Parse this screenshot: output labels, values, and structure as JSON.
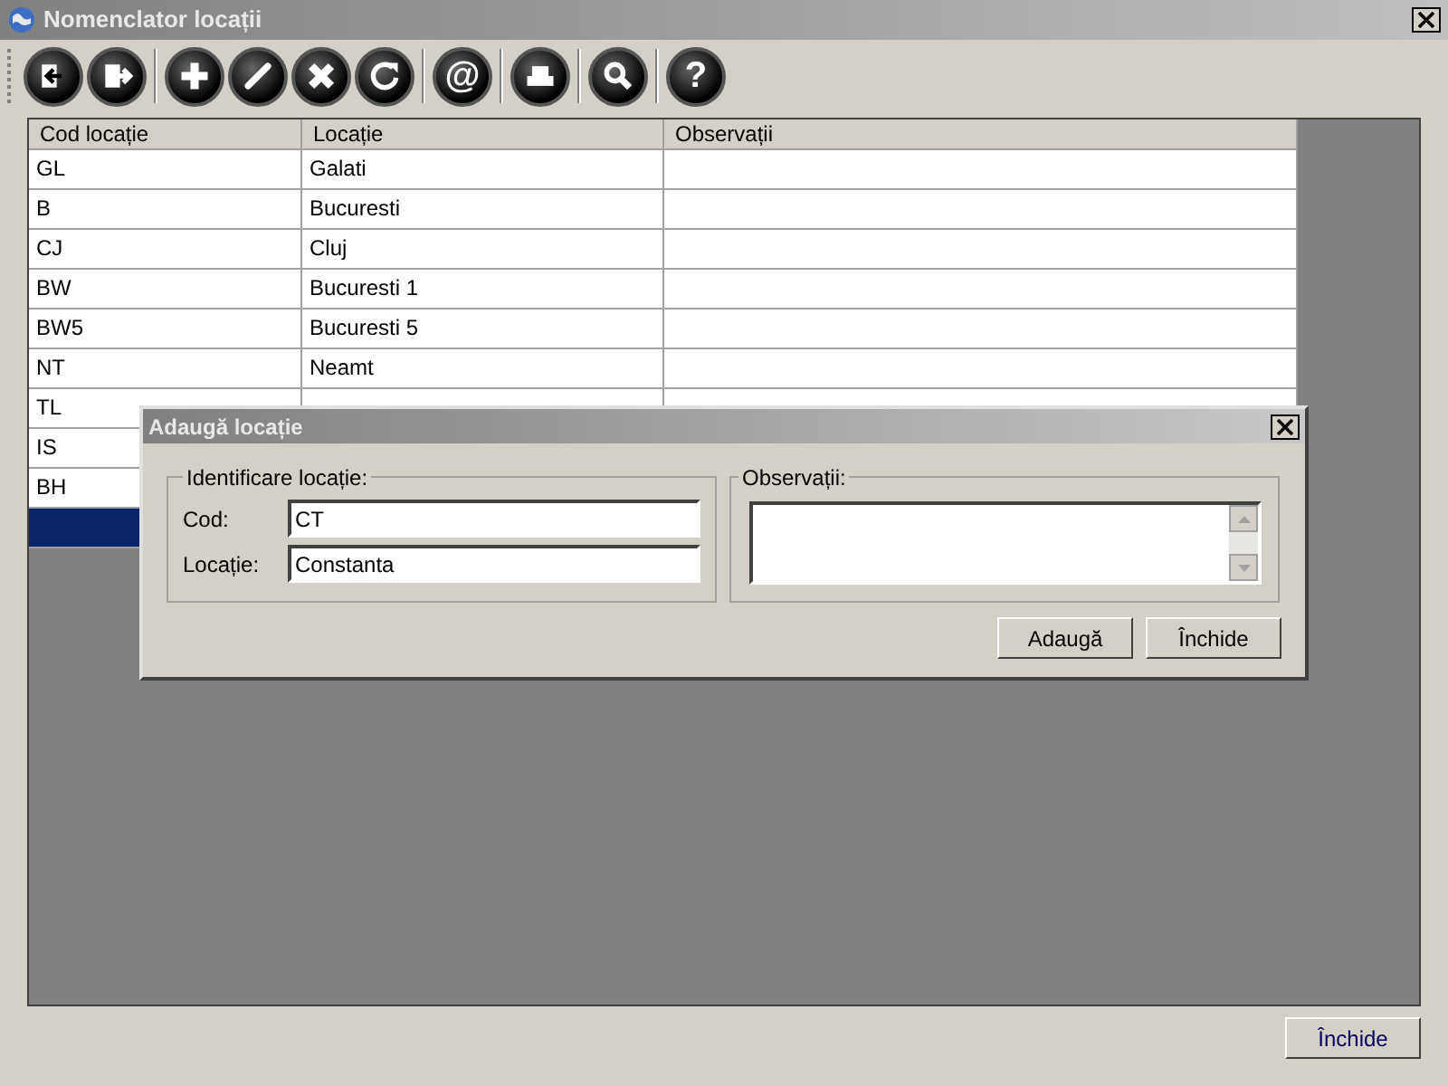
{
  "window": {
    "title": "Nomenclator locații"
  },
  "toolbar": [
    {
      "kind": "enter"
    },
    {
      "kind": "exit"
    },
    {
      "kind": "sep"
    },
    {
      "kind": "add"
    },
    {
      "kind": "edit"
    },
    {
      "kind": "delete"
    },
    {
      "kind": "refresh"
    },
    {
      "kind": "sep"
    },
    {
      "kind": "mail",
      "glyph": "@"
    },
    {
      "kind": "sep"
    },
    {
      "kind": "print"
    },
    {
      "kind": "sep"
    },
    {
      "kind": "search"
    },
    {
      "kind": "sep"
    },
    {
      "kind": "help",
      "glyph": "?"
    }
  ],
  "table": {
    "columns": [
      "Cod locație",
      "Locație",
      "Observații"
    ],
    "rows": [
      {
        "cells": [
          "GL",
          "Galati"
        ],
        "selected": false
      },
      {
        "cells": [
          "B",
          "Bucuresti"
        ],
        "selected": false
      },
      {
        "cells": [
          "CJ",
          "Cluj"
        ],
        "selected": false
      },
      {
        "cells": [
          "BW",
          "Bucuresti 1"
        ],
        "selected": false
      },
      {
        "cells": [
          "BW5",
          "Bucuresti 5"
        ],
        "selected": false
      },
      {
        "cells": [
          "NT",
          "Neamt"
        ],
        "selected": false
      },
      {
        "cells": [
          "TL"
        ],
        "selected": false
      },
      {
        "cells": [
          "IS"
        ],
        "selected": false
      },
      {
        "cells": [
          "BH"
        ],
        "selected": false
      },
      {
        "cells": [],
        "selected": true
      }
    ]
  },
  "dialog": {
    "title": "Adaugă locație",
    "group_1": {
      "title": "Identificare locație:",
      "fields": [
        {
          "label": "Cod:",
          "value": "CT"
        },
        {
          "label": "Locație:",
          "value": "Constanta"
        }
      ]
    },
    "group_2": {
      "title": "Observații:"
    },
    "buttons": [
      "Adaugă",
      "Închide"
    ]
  },
  "close_button": "Închide"
}
